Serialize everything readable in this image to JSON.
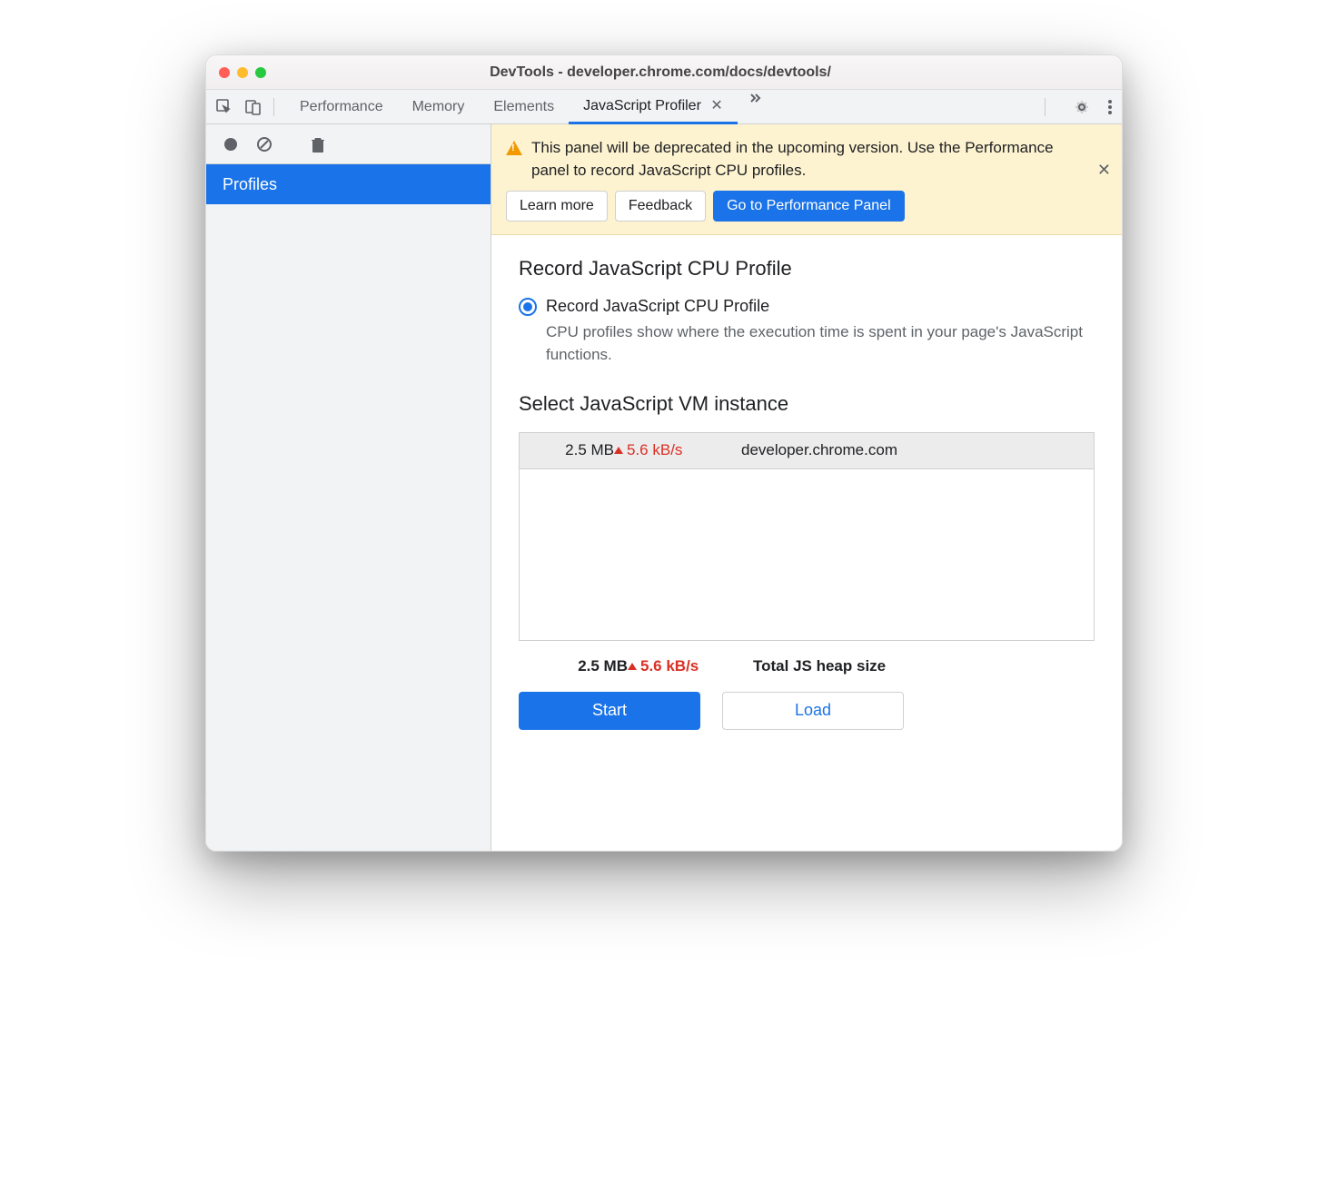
{
  "window": {
    "title": "DevTools - developer.chrome.com/docs/devtools/"
  },
  "tabs": {
    "items": [
      "Performance",
      "Memory",
      "Elements",
      "JavaScript Profiler"
    ],
    "active_index": 3
  },
  "sidebar": {
    "item_label": "Profiles"
  },
  "banner": {
    "text": "This panel will be deprecated in the upcoming version. Use the Performance panel to record JavaScript CPU profiles.",
    "learn_more": "Learn more",
    "feedback": "Feedback",
    "goto": "Go to Performance Panel"
  },
  "record": {
    "heading": "Record JavaScript CPU Profile",
    "radio_label": "Record JavaScript CPU Profile",
    "radio_desc": "CPU profiles show where the execution time is spent in your page's JavaScript functions."
  },
  "vm": {
    "heading": "Select JavaScript VM instance",
    "instances": [
      {
        "size": "2.5 MB",
        "rate": "5.6 kB/s",
        "host": "developer.chrome.com"
      }
    ]
  },
  "totals": {
    "size": "2.5 MB",
    "rate": "5.6 kB/s",
    "label": "Total JS heap size"
  },
  "actions": {
    "start": "Start",
    "load": "Load"
  }
}
